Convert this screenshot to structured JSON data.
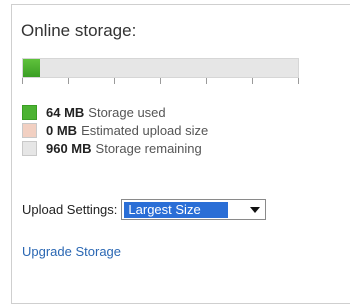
{
  "storage": {
    "title": "Online storage:",
    "bar": {
      "used_fraction": 0.0625,
      "fill_color": "#4cb332",
      "track_color": "#e6e6e6"
    },
    "legend": [
      {
        "amount": "64 MB",
        "label": "Storage used",
        "color": "#4cb332"
      },
      {
        "amount": "0 MB",
        "label": "Estimated upload size",
        "color": "#f2d0c2"
      },
      {
        "amount": "960 MB",
        "label": "Storage remaining",
        "color": "#e6e6e6"
      }
    ]
  },
  "upload": {
    "label": "Upload Settings:",
    "selected_option": "Largest Size"
  },
  "upgrade_link": "Upgrade Storage"
}
